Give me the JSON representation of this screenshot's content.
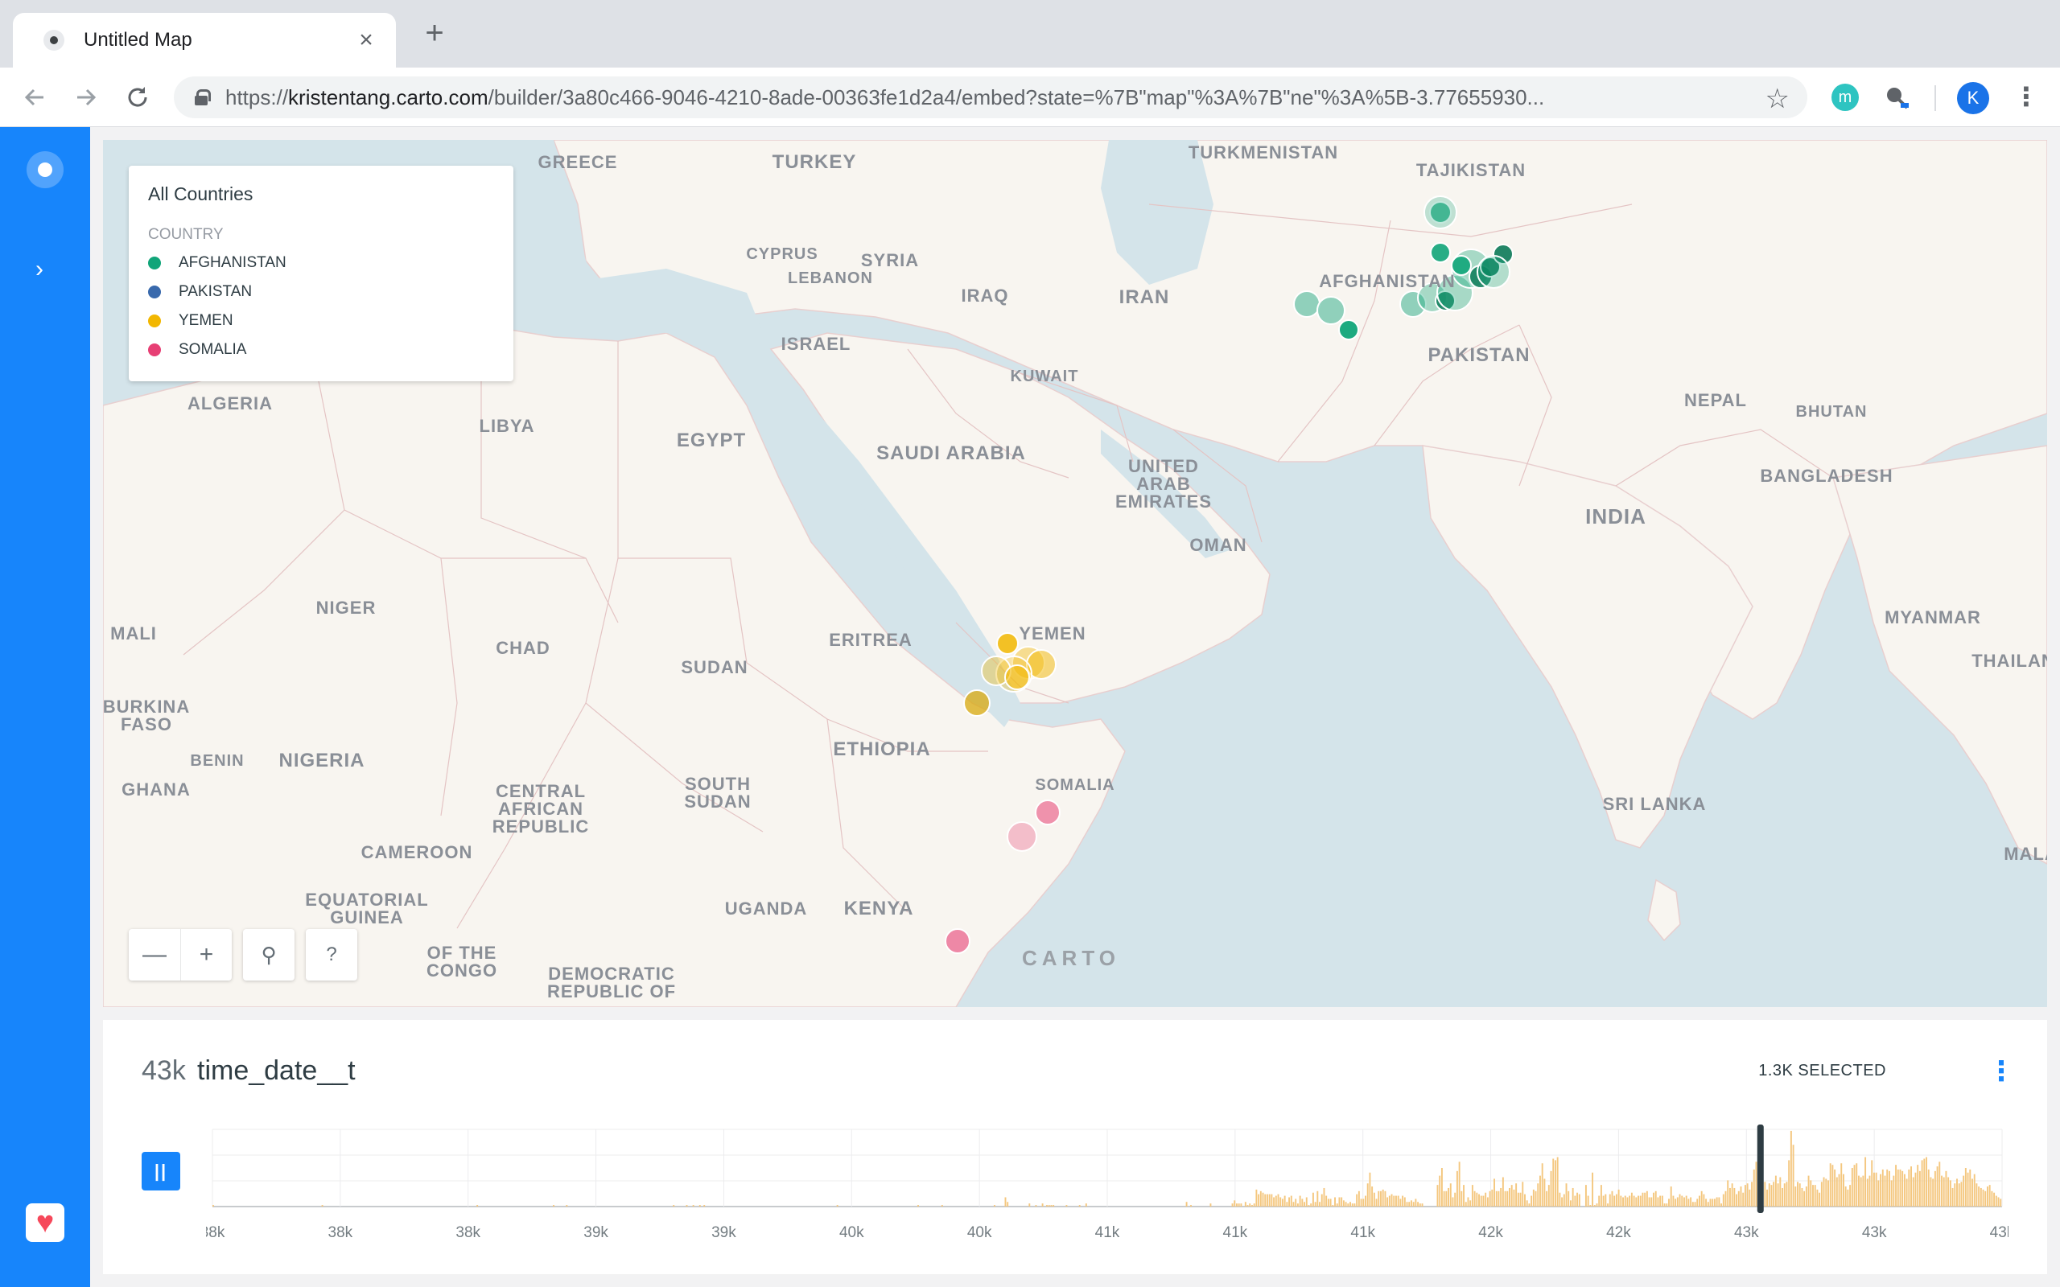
{
  "browser": {
    "tab_title": "Untitled Map",
    "tab_close": "×",
    "new_tab": "+",
    "url_prefix": "https://",
    "url_host": "kristentang.carto.com",
    "url_rest": "/builder/3a80c466-9046-4210-8ade-00363fe1d2a4/embed?state=%7B\"map\"%3A%7B\"ne\"%3A%5B-3.77655930...",
    "profile_initial": "K",
    "ext1_letter": "m"
  },
  "legend": {
    "title": "All Countries",
    "subtitle": "COUNTRY",
    "items": [
      {
        "label": "AFGHANISTAN",
        "color": "#11a579"
      },
      {
        "label": "PAKISTAN",
        "color": "#3969ac"
      },
      {
        "label": "YEMEN",
        "color": "#f2b701"
      },
      {
        "label": "SOMALIA",
        "color": "#e73f74"
      }
    ]
  },
  "map_labels": {
    "greece": "GREECE",
    "turkey": "TURKEY",
    "turkmenistan": "TURKMENISTAN",
    "tajikistan": "TAJIKISTAN",
    "cyprus": "CYPRUS",
    "syria": "SYRIA",
    "lebanon": "LEBANON",
    "iraq": "IRAQ",
    "iran": "IRAN",
    "afghanistan": "AFGHANISTAN",
    "israel": "ISRAEL",
    "kuwait": "KUWAIT",
    "pakistan": "PAKISTAN",
    "nepal": "NEPAL",
    "bhutan": "BHUTAN",
    "algeria": "ALGERIA",
    "libya": "LIBYA",
    "egypt": "EGYPT",
    "saudi_arabia": "SAUDI ARABIA",
    "uae": "UNITED\nARAB\nEMIRATES",
    "bangladesh": "BANGLADESH",
    "oman": "OMAN",
    "india": "INDIA",
    "niger": "NIGER",
    "mali": "MALI",
    "chad": "CHAD",
    "eritrea": "ERITREA",
    "yemen": "YEMEN",
    "sudan": "SUDAN",
    "myanmar": "MYANMAR",
    "thailand": "THAILAN",
    "burkina": "BURKINA\nFASO",
    "benin": "BENIN",
    "nigeria": "NIGERIA",
    "ethiopia": "ETHIOPIA",
    "ghana": "GHANA",
    "somalia": "SOMALIA",
    "car": "CENTRAL\nAFRICAN\nREPUBLIC",
    "south_sudan": "SOUTH\nSUDAN",
    "sri_lanka": "SRI LANKA",
    "cameroon": "CAMEROON",
    "malaysia": "MALA",
    "eq_guinea": "EQUATORIAL\nGUINEA",
    "uganda": "UGANDA",
    "kenya": "KENYA",
    "congo": "OF THE\nCONGO",
    "drc": "DEMOCRATIC\nREPUBLIC OF"
  },
  "map_controls": {
    "zoom_out": "—",
    "zoom_in": "+",
    "search": "⚲",
    "help": "?",
    "attribution": "CARTO"
  },
  "widget": {
    "count": "43k",
    "title": "time_date__t",
    "selected": "1.3K SELECTED",
    "menu": "⋮",
    "play": "||"
  },
  "chart_data": {
    "type": "bar",
    "title": "time_date__t",
    "x_tick_labels": [
      "38k",
      "38k",
      "38k",
      "39k",
      "39k",
      "40k",
      "40k",
      "41k",
      "41k",
      "41k",
      "42k",
      "42k",
      "43k",
      "43k",
      "43k"
    ],
    "bar_color": "#f4c77f",
    "cursor_position_fraction": 0.865,
    "values": [
      2,
      0,
      0,
      0,
      0,
      0,
      0,
      0,
      0,
      0,
      0,
      0,
      0,
      0,
      0,
      0,
      0,
      0,
      0,
      0,
      0,
      0,
      0,
      0,
      0,
      0,
      0,
      0,
      0,
      0,
      0,
      0,
      0,
      0,
      0,
      0,
      0,
      0,
      0,
      0,
      0,
      0,
      0,
      0,
      0,
      0,
      0,
      0,
      0,
      0,
      2,
      0,
      0,
      0,
      0,
      0,
      0,
      0,
      0,
      0,
      0,
      0,
      0,
      0,
      0,
      0,
      0,
      0,
      0,
      0,
      0,
      0,
      0,
      0,
      0,
      0,
      0,
      0,
      0,
      0,
      0,
      0,
      0,
      0,
      0,
      0,
      0,
      0,
      0,
      0,
      0,
      0,
      0,
      0,
      0,
      0,
      0,
      0,
      0,
      0,
      0,
      0,
      0,
      0,
      0,
      0,
      0,
      0,
      0,
      0,
      0,
      0,
      0,
      0,
      0,
      0,
      0,
      0,
      0,
      0,
      0,
      2,
      0,
      0,
      0,
      0,
      0,
      0,
      0,
      0,
      0,
      0,
      0,
      0,
      0,
      0,
      0,
      0,
      0,
      0,
      0,
      0,
      0,
      0,
      0,
      0,
      0,
      0,
      0,
      0,
      0,
      0,
      0,
      0,
      0,
      0,
      2,
      0,
      0,
      0,
      0,
      0,
      2,
      0,
      0,
      0,
      0,
      0,
      0,
      0,
      0,
      0,
      0,
      0,
      0,
      0,
      0,
      0,
      0,
      0,
      0,
      0,
      0,
      0,
      0,
      0,
      0,
      0,
      0,
      0,
      0,
      0,
      0,
      0,
      0,
      0,
      0,
      0,
      0,
      0,
      0,
      0,
      0,
      0,
      0,
      0,
      0,
      0,
      0,
      0,
      0,
      2,
      0,
      0,
      0,
      0,
      0,
      2,
      0,
      0,
      2,
      0,
      0,
      2,
      0,
      2,
      0,
      0,
      0,
      0,
      0,
      0,
      0,
      0,
      0,
      0,
      0,
      0,
      0,
      0,
      0,
      0,
      0,
      0,
      0,
      0,
      0,
      0,
      0,
      0,
      0,
      0,
      0,
      0,
      0,
      0,
      0,
      0,
      0,
      0,
      0,
      0,
      0,
      0,
      0,
      0,
      0,
      0,
      0,
      0,
      0,
      0,
      0,
      0,
      0,
      0,
      0,
      0,
      0,
      0,
      0,
      0,
      0,
      0,
      0,
      0,
      2,
      0,
      0,
      0,
      0,
      0,
      0,
      0,
      0,
      0,
      0,
      0,
      0,
      0,
      0,
      0,
      0,
      0,
      0,
      0,
      0,
      0,
      0,
      0,
      0,
      0,
      0,
      0,
      0,
      0,
      0,
      0,
      0,
      0,
      0,
      0,
      0,
      2,
      0,
      0,
      0,
      0,
      0,
      0,
      0,
      0,
      0,
      0,
      2,
      0,
      0,
      0,
      0,
      0,
      0,
      0,
      0,
      0,
      0,
      0,
      0,
      0,
      0,
      0,
      0,
      0,
      0,
      0,
      0,
      0,
      0,
      0,
      2,
      0,
      0,
      0,
      0,
      12,
      6,
      0,
      0,
      0,
      0,
      0,
      0,
      0,
      0,
      0,
      4,
      0,
      0,
      2,
      0,
      0,
      4,
      0,
      2,
      2,
      2,
      2,
      0,
      0,
      0,
      0,
      0,
      2,
      0,
      0,
      0,
      0,
      0,
      2,
      0,
      0,
      4,
      0,
      0,
      0,
      0,
      0,
      0,
      0,
      0,
      0,
      0,
      0,
      0,
      0,
      0,
      0,
      0,
      0,
      0,
      0,
      0,
      0,
      0,
      0,
      0,
      0,
      0,
      0,
      0,
      0,
      0,
      0,
      0,
      0,
      0,
      0,
      0,
      0,
      0,
      0,
      0,
      0,
      0,
      0,
      0,
      0,
      6,
      0,
      2,
      0,
      0,
      0,
      0,
      0,
      0,
      0,
      0,
      4,
      0,
      0,
      0,
      0,
      0,
      0,
      0,
      0,
      0,
      4,
      8,
      4,
      4,
      4,
      0,
      6,
      2,
      4,
      2,
      4,
      22,
      16,
      20,
      18,
      16,
      16,
      16,
      16,
      12,
      14,
      16,
      12,
      10,
      14,
      6,
      12,
      14,
      6,
      10,
      4,
      14,
      10,
      6,
      12,
      2,
      4,
      18,
      6,
      20,
      6,
      16,
      24,
      14,
      10,
      10,
      2,
      12,
      4,
      12,
      12,
      8,
      6,
      4,
      6,
      4,
      4,
      16,
      20,
      10,
      10,
      14,
      30,
      44,
      26,
      18,
      10,
      20,
      20,
      22,
      20,
      12,
      14,
      16,
      14,
      14,
      14,
      10,
      14,
      12,
      6,
      6,
      8,
      6,
      10,
      6,
      4,
      4,
      0,
      0,
      0,
      0,
      0,
      0,
      28,
      40,
      50,
      20,
      20,
      24,
      30,
      12,
      18,
      46,
      58,
      20,
      28,
      6,
      12,
      8,
      28,
      20,
      18,
      16,
      14,
      14,
      18,
      12,
      20,
      22,
      36,
      20,
      20,
      24,
      38,
      20,
      20,
      24,
      28,
      22,
      30,
      18,
      18,
      32,
      16,
      8,
      4,
      14,
      22,
      20,
      30,
      40,
      56,
      36,
      20,
      28,
      46,
      62,
      60,
      64,
      18,
      12,
      16,
      30,
      20,
      8,
      24,
      14,
      18,
      16,
      0,
      0,
      28,
      14,
      2,
      44,
      2,
      4,
      14,
      28,
      14,
      16,
      4,
      16,
      20,
      14,
      16,
      22,
      14,
      12,
      14,
      12,
      14,
      18,
      14,
      12,
      14,
      14,
      18,
      18,
      20,
      12,
      12,
      18,
      20,
      12,
      14,
      14,
      4,
      4,
      10,
      26,
      14,
      10,
      12,
      16,
      14,
      12,
      14,
      10,
      12,
      6,
      6,
      10,
      14,
      20,
      16,
      10,
      6,
      10,
      10,
      10,
      12,
      12,
      4,
      16,
      20,
      34,
      24,
      30,
      24,
      16,
      20,
      26,
      18,
      28,
      30,
      22,
      32,
      48,
      58,
      62,
      36,
      32,
      32,
      22,
      30,
      28,
      32,
      40,
      30,
      38,
      24,
      30,
      32,
      60,
      98,
      80,
      26,
      32,
      30,
      24,
      20,
      26,
      40,
      34,
      28,
      28,
      22,
      18,
      32,
      38,
      36,
      34,
      56,
      54,
      48,
      38,
      42,
      56,
      42,
      26,
      22,
      28,
      50,
      54,
      56,
      40,
      38,
      40,
      64,
      36,
      40,
      60,
      44,
      44,
      34,
      42,
      48,
      40,
      48,
      46,
      34,
      40,
      54,
      48,
      48,
      46,
      42,
      36,
      48,
      52,
      38,
      44,
      54,
      46,
      60,
      62,
      64,
      48,
      38,
      36,
      46,
      52,
      58,
      40,
      38,
      46,
      38,
      34,
      24,
      30,
      36,
      30,
      32,
      40,
      50,
      44,
      48,
      36,
      42,
      30,
      26,
      24,
      22,
      20,
      26,
      28,
      20,
      18,
      14,
      12,
      10
    ]
  }
}
